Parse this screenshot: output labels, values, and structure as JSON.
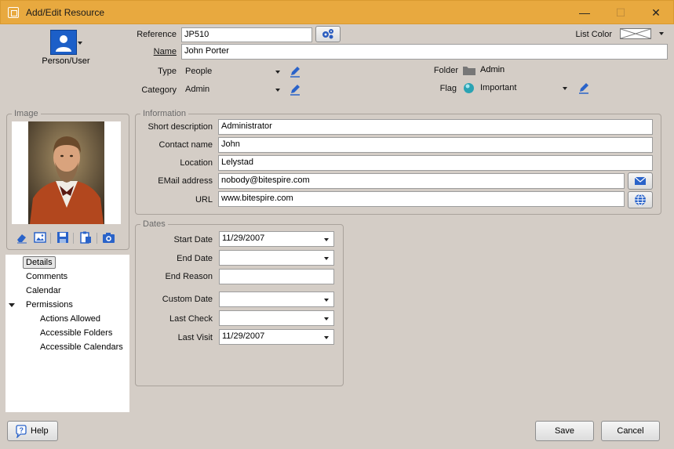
{
  "window": {
    "title": "Add/Edit Resource",
    "minimize_label": "—",
    "maximize_label": "☐",
    "close_label": "✕"
  },
  "header": {
    "resource_type_label": "Person/User",
    "reference_label": "Reference",
    "reference_value": "JP510",
    "name_label": "Name",
    "name_value": "John Porter",
    "type_label": "Type",
    "type_value": "People",
    "category_label": "Category",
    "category_value": "Admin",
    "list_color_label": "List Color",
    "folder_label": "Folder",
    "folder_value": "Admin",
    "flag_label": "Flag",
    "flag_value": "Important"
  },
  "image_panel": {
    "legend": "Image",
    "tools": [
      "eraser-icon",
      "image-icon",
      "save-icon",
      "paste-icon",
      "camera-icon"
    ]
  },
  "tree": {
    "items": [
      {
        "label": "Details",
        "selected": true
      },
      {
        "label": "Comments"
      },
      {
        "label": "Calendar"
      },
      {
        "label": "Permissions",
        "expanded": true
      },
      {
        "label": "Actions Allowed"
      },
      {
        "label": "Accessible Folders"
      },
      {
        "label": "Accessible Calendars"
      }
    ]
  },
  "information": {
    "legend": "Information",
    "short_description_label": "Short description",
    "short_description_value": "Administrator",
    "contact_name_label": "Contact name",
    "contact_name_value": "John",
    "location_label": "Location",
    "location_value": "Lelystad",
    "email_label": "EMail address",
    "email_value": "nobody@bitespire.com",
    "url_label": "URL",
    "url_value": "www.bitespire.com"
  },
  "dates": {
    "legend": "Dates",
    "start_date_label": "Start Date",
    "start_date_value": "11/29/2007",
    "end_date_label": "End Date",
    "end_date_value": "",
    "end_reason_label": "End Reason",
    "end_reason_value": "",
    "custom_date_label": "Custom Date",
    "custom_date_value": "",
    "last_check_label": "Last Check",
    "last_check_value": "",
    "last_visit_label": "Last Visit",
    "last_visit_value": "11/29/2007"
  },
  "footer": {
    "help_label": "Help",
    "save_label": "Save",
    "cancel_label": "Cancel"
  },
  "colors": {
    "titlebar": "#e8a93f",
    "background": "#d4cdc6",
    "accent_blue": "#1c5fc8"
  }
}
